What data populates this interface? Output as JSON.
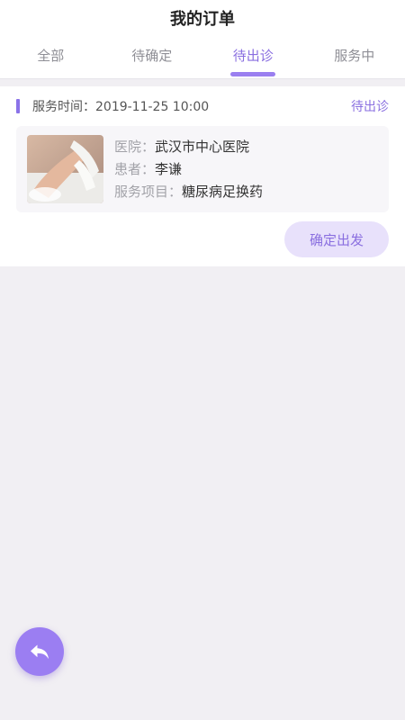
{
  "header": {
    "title": "我的订单"
  },
  "tabs": [
    {
      "label": "全部",
      "active": false
    },
    {
      "label": "待确定",
      "active": false
    },
    {
      "label": "待出诊",
      "active": true
    },
    {
      "label": "服务中",
      "active": false
    }
  ],
  "order": {
    "service_time": "服务时间：2019-11-25 10:00",
    "status": "待出诊",
    "hospital_label": "医院：",
    "hospital": "武汉市中心医院",
    "patient_label": "患者：",
    "patient": "李谦",
    "service_label": "服务项目：",
    "service": "糖尿病足换药",
    "confirm_button": "确定出发"
  },
  "colors": {
    "accent": "#8a6fe0",
    "background": "#f1eff3",
    "button_bg": "#e8e1fb",
    "fab": "#9b7ef2"
  },
  "icons": {
    "fab": "undo-arrow-icon",
    "thumbnail": "foot-care-photo"
  }
}
